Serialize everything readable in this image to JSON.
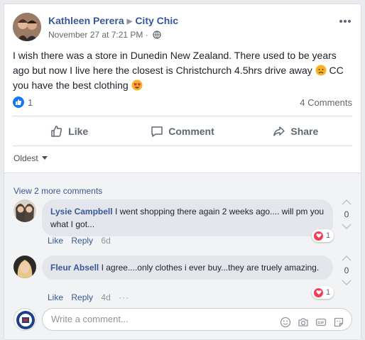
{
  "post": {
    "author": "Kathleen Perera",
    "target": "City Chic",
    "date": "November 27 at 7:21 PM",
    "separator": "·",
    "text": "I wish there was a store in Dunedin New Zealand. There used to be years ago but now I live here the closest is Christchurch 4.5hrs drive away",
    "text_tail": "CC you have the best clothing",
    "like_count": "1",
    "comment_count": "4 Comments"
  },
  "actions": {
    "like": "Like",
    "comment": "Comment",
    "share": "Share"
  },
  "sort": {
    "label": "Oldest"
  },
  "comments_section": {
    "view_more": "View 2 more comments",
    "items": [
      {
        "name": "Lysie Campbell",
        "text": "I went shopping there again 2 weeks ago.... will pm you what I got...",
        "like": "Like",
        "reply": "Reply",
        "time": "6d",
        "reactions": "1",
        "votes": "0"
      },
      {
        "name": "Fleur Absell",
        "text": "I agree....only clothes i ever buy...they are truely amazing.",
        "like": "Like",
        "reply": "Reply",
        "time": "4d",
        "more": "···",
        "reactions": "1",
        "votes": "0"
      }
    ]
  },
  "composer": {
    "placeholder": "Write a comment..."
  },
  "colors": {
    "link_blue": "#365899",
    "like_blue": "#1877f2",
    "heart_red": "#f33e58"
  }
}
